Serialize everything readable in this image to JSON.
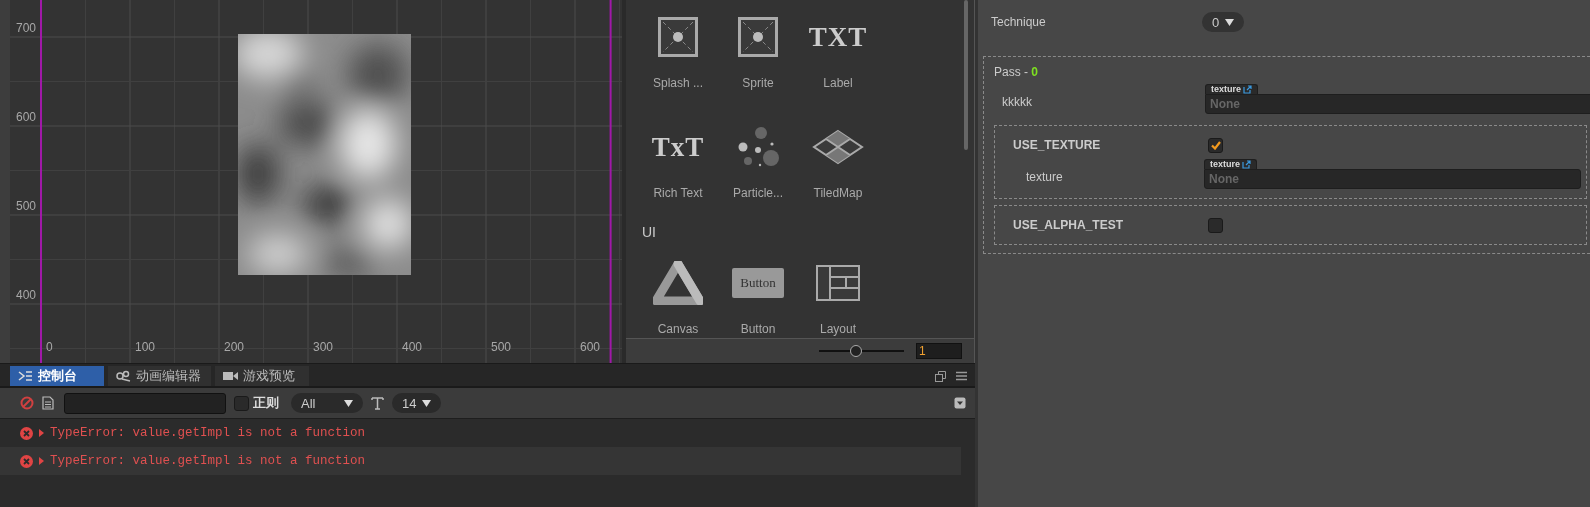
{
  "scene_view": {
    "y_axis_labels": [
      "700",
      "600",
      "500",
      "400"
    ],
    "x_axis_labels": [
      "0",
      "100",
      "200",
      "300",
      "400",
      "500",
      "600"
    ]
  },
  "asset_panel": {
    "sections": [
      {
        "items": [
          {
            "kind": "sprite",
            "label": "Splash ..."
          },
          {
            "kind": "sprite",
            "label": "Sprite"
          },
          {
            "kind": "text",
            "glyph": "TXT",
            "label": "Label"
          }
        ]
      },
      {
        "items": [
          {
            "kind": "text",
            "glyph": "TxT",
            "label": "Rich Text"
          },
          {
            "kind": "particle",
            "label": "Particle..."
          },
          {
            "kind": "tiledmap",
            "label": "TiledMap"
          }
        ]
      },
      {
        "title": "UI",
        "items": [
          {
            "kind": "canvas",
            "label": "Canvas"
          },
          {
            "kind": "button",
            "glyph": "Button",
            "label": "Button"
          },
          {
            "kind": "layout",
            "label": "Layout"
          }
        ]
      }
    ],
    "zoom_slider": {
      "level": 0.44
    },
    "zoom_value": "1"
  },
  "console": {
    "tabs": [
      {
        "kind": "console",
        "label": "控制台",
        "selected": true
      },
      {
        "kind": "animation",
        "label": "动画编辑器",
        "selected": false
      },
      {
        "kind": "camera",
        "label": "游戏预览",
        "selected": false
      }
    ],
    "toolbar": {
      "regex": {
        "label": "正则",
        "checked": false
      },
      "level_filter": "All",
      "font_size": "14"
    },
    "rows": [
      {
        "kind": "error",
        "text": "TypeError: value.getImpl is not a function"
      },
      {
        "kind": "error",
        "text": "TypeError: value.getImpl is not a function"
      }
    ]
  },
  "inspector": {
    "technique": {
      "label": "Technique",
      "value": "0"
    },
    "pass": {
      "title": "Pass -",
      "index": "0",
      "properties": [
        {
          "kind": "texture",
          "label": "kkkkk",
          "tag": "texture",
          "placeholder": "None"
        }
      ],
      "defines": [
        {
          "label": "USE_TEXTURE",
          "checked": true,
          "children": [
            {
              "kind": "texture",
              "label": "texture",
              "tag": "texture",
              "placeholder": "None"
            }
          ]
        },
        {
          "label": "USE_ALPHA_TEST",
          "checked": false
        }
      ]
    }
  }
}
